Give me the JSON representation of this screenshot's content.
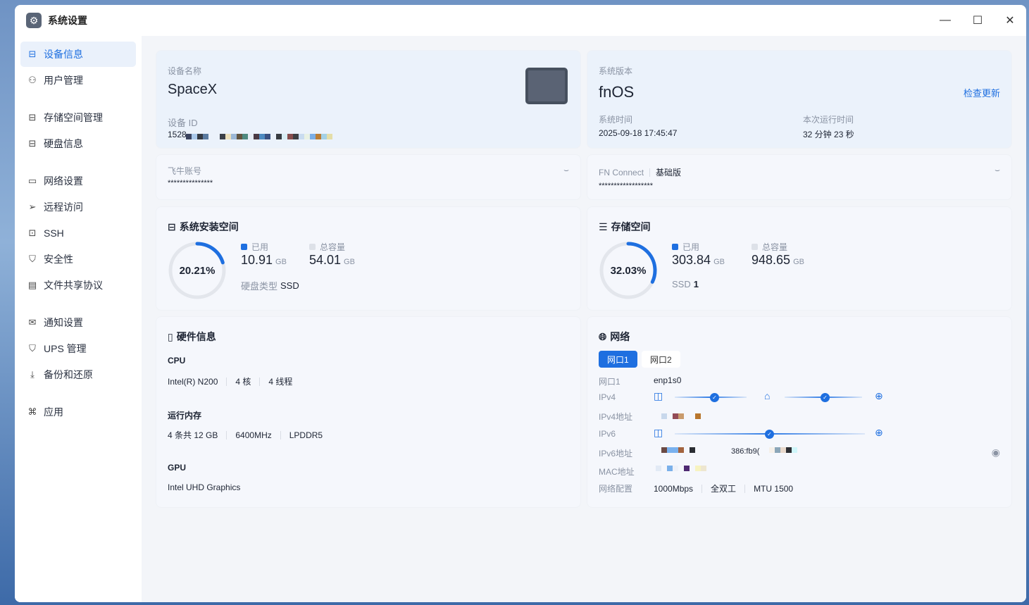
{
  "window": {
    "title": "系统设置"
  },
  "sidebar": {
    "items": [
      {
        "label": "设备信息",
        "icon": "device-icon"
      },
      {
        "label": "用户管理",
        "icon": "users-icon"
      },
      {
        "label": "存储空间管理",
        "icon": "storage-icon"
      },
      {
        "label": "硬盘信息",
        "icon": "disk-icon"
      },
      {
        "label": "网络设置",
        "icon": "network-icon"
      },
      {
        "label": "远程访问",
        "icon": "send-icon"
      },
      {
        "label": "SSH",
        "icon": "terminal-icon"
      },
      {
        "label": "安全性",
        "icon": "shield-icon"
      },
      {
        "label": "文件共享协议",
        "icon": "file-icon"
      },
      {
        "label": "通知设置",
        "icon": "mail-icon"
      },
      {
        "label": "UPS 管理",
        "icon": "ups-icon"
      },
      {
        "label": "备份和还原",
        "icon": "backup-icon"
      },
      {
        "label": "应用",
        "icon": "apps-icon"
      }
    ]
  },
  "device": {
    "name_label": "设备名称",
    "name": "SpaceX",
    "id_label": "设备 ID",
    "id_prefix": "1528"
  },
  "system": {
    "version_label": "系统版本",
    "version": "fnOS",
    "check_update": "检查更新",
    "time_label": "系统时间",
    "time": "2025-09-18 17:45:47",
    "uptime_label": "本次运行时间",
    "uptime": "32 分钟 23 秒"
  },
  "account": {
    "label": "飞牛账号",
    "value": "***************"
  },
  "connect": {
    "label": "FN Connect",
    "tier": "基础版",
    "value": "******************"
  },
  "sys_space": {
    "title": "系统安装空间",
    "percent": "20.21%",
    "fraction": 0.2021,
    "used_label": "已用",
    "used": "10.91",
    "total_label": "总容量",
    "total": "54.01",
    "unit": "GB",
    "disk_type_label": "硬盘类型",
    "disk_type": "SSD"
  },
  "storage": {
    "title": "存储空间",
    "percent": "32.03%",
    "fraction": 0.3203,
    "used_label": "已用",
    "used": "303.84",
    "total_label": "总容量",
    "total": "948.65",
    "unit": "GB",
    "ssd_label": "SSD",
    "ssd_count": "1"
  },
  "hardware": {
    "title": "硬件信息",
    "cpu_label": "CPU",
    "cpu": [
      "Intel(R) N200",
      "4 核",
      "4 线程"
    ],
    "ram_label": "运行内存",
    "ram": [
      "4 条共 12 GB",
      "6400MHz",
      "LPDDR5"
    ],
    "gpu_label": "GPU",
    "gpu": "Intel UHD Graphics"
  },
  "network": {
    "title": "网络",
    "tabs": [
      "网口1",
      "网口2"
    ],
    "port_label": "网口1",
    "port": "enp1s0",
    "ipv4_label": "IPv4",
    "ipv4_addr_label": "IPv4地址",
    "ipv6_label": "IPv6",
    "ipv6_addr_label": "IPv6地址",
    "ipv6_partial": "386:fb9(",
    "mac_label": "MAC地址",
    "config_label": "网络配置",
    "config": [
      "1000Mbps",
      "全双工",
      "MTU 1500"
    ]
  },
  "colors": {
    "accent": "#1e6fe0",
    "ring_track": "#e3e6ec"
  }
}
